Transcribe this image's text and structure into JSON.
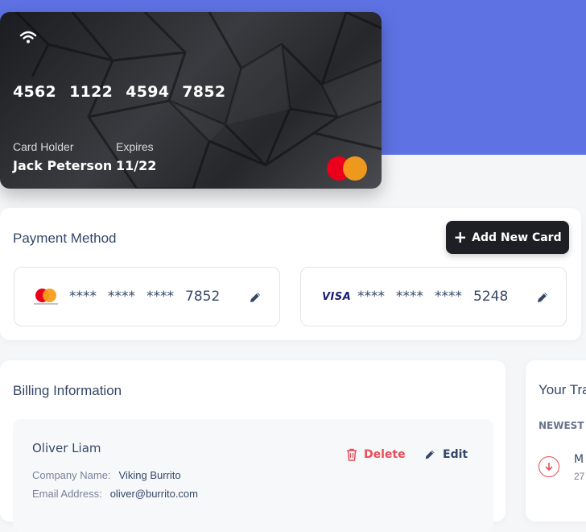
{
  "credit_card": {
    "number_groups": [
      "4562",
      "1122",
      "4594",
      "7852"
    ],
    "holder_label": "Card Holder",
    "holder_name": "Jack Peterson",
    "expires_label": "Expires",
    "expires_value": "11/22",
    "brand": "mastercard",
    "wifi_icon": "wifi-icon"
  },
  "payment_method": {
    "title": "Payment Method",
    "add_button_label": "Add New Card",
    "cards": [
      {
        "brand": "mastercard",
        "brand_caption": "mastercard",
        "mask": [
          "****",
          "****",
          "****"
        ],
        "last4": "7852"
      },
      {
        "brand": "visa",
        "brand_text": "VISA",
        "mask": [
          "****",
          "****",
          "****"
        ],
        "last4": "5248"
      }
    ]
  },
  "billing": {
    "title": "Billing Information",
    "entries": [
      {
        "name": "Oliver Liam",
        "delete_label": "Delete",
        "edit_label": "Edit",
        "company_label": "Company Name:",
        "company_value": "Viking Burrito",
        "email_label": "Email Address:",
        "email_value": "oliver@burrito.com"
      }
    ]
  },
  "transactions": {
    "title": "Your Tra",
    "section_label": "NEWEST",
    "items": [
      {
        "name": "M",
        "date": "27",
        "direction": "down",
        "status_color": "#ea4c57"
      }
    ]
  },
  "colors": {
    "accent": "#5e72e4",
    "dark_button": "#1d1f25",
    "danger": "#ea4c57",
    "text": "#344767"
  }
}
